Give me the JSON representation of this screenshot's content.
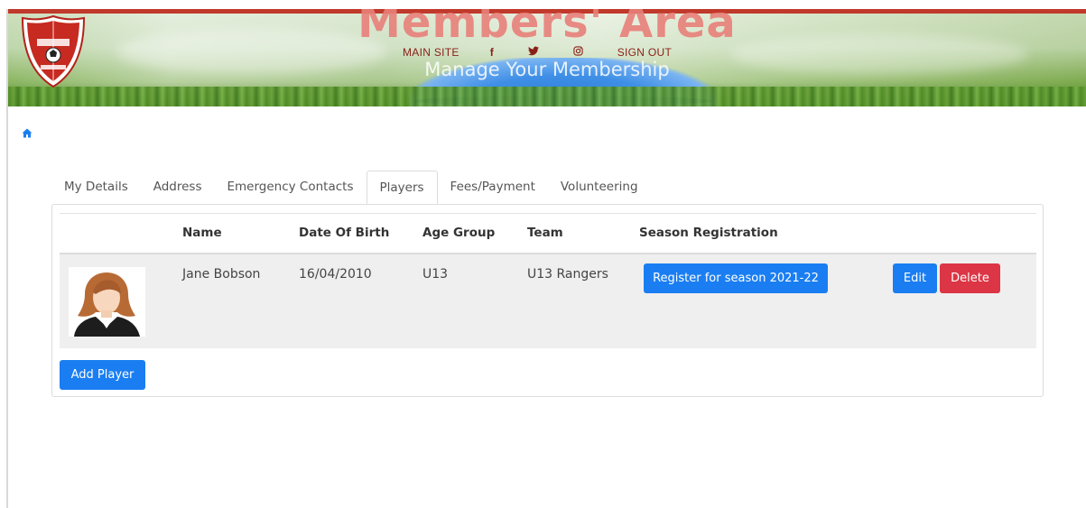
{
  "header": {
    "title": "Members' Area",
    "subtitle": "Manage Your Membership",
    "nav": {
      "main_site": "MAIN SITE",
      "facebook_icon": "f",
      "twitter_icon": "twitter-icon",
      "instagram_icon": "instagram-icon",
      "sign_out": "SIGN OUT"
    },
    "logo_alt": "Football Club crest"
  },
  "breadcrumb": {
    "home_icon": "home-icon"
  },
  "tabs": [
    {
      "label": "My Details",
      "active": false
    },
    {
      "label": "Address",
      "active": false
    },
    {
      "label": "Emergency Contacts",
      "active": false
    },
    {
      "label": "Players",
      "active": true
    },
    {
      "label": "Fees/Payment",
      "active": false
    },
    {
      "label": "Volunteering",
      "active": false
    }
  ],
  "players_table": {
    "columns": {
      "name": "Name",
      "dob": "Date Of Birth",
      "age_group": "Age Group",
      "team": "Team",
      "season_registration": "Season Registration"
    },
    "rows": [
      {
        "name": "Jane Bobson",
        "dob": "16/04/2010",
        "age_group": "U13",
        "team": "U13 Rangers",
        "register_label": "Register for season 2021-22",
        "edit_label": "Edit",
        "delete_label": "Delete"
      }
    ]
  },
  "actions": {
    "add_player": "Add Player"
  },
  "colors": {
    "primary": "#1a7ef2",
    "danger": "#dc3545",
    "banner_red": "#c0392b",
    "nav_text": "#8a1f17"
  }
}
